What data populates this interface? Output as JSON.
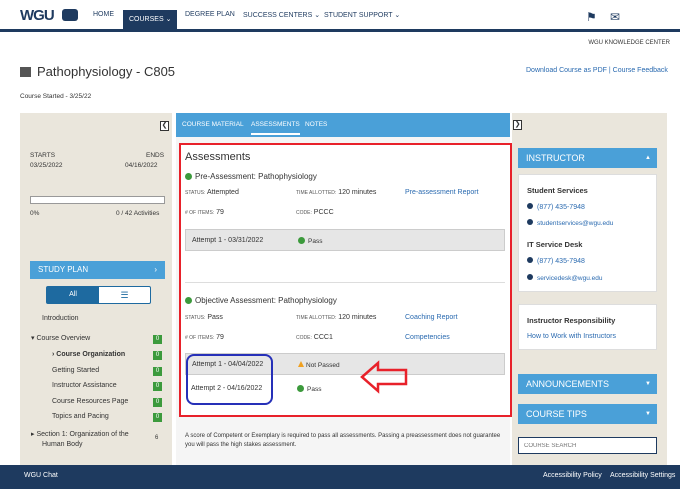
{
  "topnav": {
    "logo": "WGU",
    "items": [
      "HOME",
      "COURSES",
      "DEGREE PLAN",
      "SUCCESS CENTERS",
      "STUDENT SUPPORT"
    ],
    "icons": [
      "flag-icon",
      "mail-icon"
    ]
  },
  "knowledge_center": "WGU KNOWLEDGE CENTER",
  "course": {
    "title": "Pathophysiology - C805",
    "download": "Download Course as PDF",
    "separator": "|",
    "feedback": "Course Feedback",
    "started": "Course Started - 3/25/22"
  },
  "left": {
    "starts_label": "STARTS",
    "starts": "03/25/2022",
    "ends_label": "ENDS",
    "ends": "04/16/2022",
    "percent": "0%",
    "progress_fraction": 0,
    "activities": "0 / 42 Activities",
    "study_plan": "STUDY PLAN",
    "toggle_all": "All",
    "items": [
      {
        "label": "Introduction",
        "badge": ""
      },
      {
        "label": "Course Overview",
        "badge": "0"
      },
      {
        "label": "Course Organization",
        "badge": "0"
      },
      {
        "label": "Getting Started",
        "badge": "0"
      },
      {
        "label": "Instructor Assistance",
        "badge": "0"
      },
      {
        "label": "Course Resources Page",
        "badge": "0"
      },
      {
        "label": "Topics and Pacing",
        "badge": "0"
      },
      {
        "label": "Section 1: Organization of the",
        "label2": "Human Body",
        "badge": "6"
      }
    ]
  },
  "tabs": [
    "COURSE MATERIAL",
    "ASSESSMENTS",
    "NOTES"
  ],
  "assessments": {
    "title": "Assessments",
    "pre": {
      "name": "Pre-Assessment: Pathophysiology",
      "status_label": "STATUS:",
      "status": "Attempted",
      "time_label": "TIME ALLOTTED:",
      "time": "120 minutes",
      "report": "Pre-assessment Report",
      "items_label": "# OF ITEMS:",
      "items": "79",
      "code_label": "CODE:",
      "code": "PCCC",
      "attempts": [
        {
          "label": "Attempt 1 - 03/31/2022",
          "result": "Pass"
        }
      ]
    },
    "obj": {
      "name": "Objective Assessment: Pathophysiology",
      "status_label": "STATUS:",
      "status": "Pass",
      "time_label": "TIME ALLOTTED:",
      "time": "120 minutes",
      "report": "Coaching Report",
      "items_label": "# OF ITEMS:",
      "items": "79",
      "code_label": "CODE:",
      "code": "CCC1",
      "competencies": "Competencies",
      "attempts": [
        {
          "label": "Attempt 1 - 04/04/2022",
          "result": "Not Passed"
        },
        {
          "label": "Attempt 2 - 04/16/2022",
          "result": "Pass"
        }
      ]
    },
    "disclaimer": "A score of Competent or Exemplary is required to pass all assessments. Passing a preassessment does not guarantee you will pass the high stakes assessment."
  },
  "right": {
    "instructor": "INSTRUCTOR",
    "student_services": "Student Services",
    "ss_phone": "(877) 435-7948",
    "ss_email": "studentservices@wgu.edu",
    "it_desk": "IT Service Desk",
    "it_phone": "(877) 435-7948",
    "it_email": "servicedesk@wgu.edu",
    "responsibility": "Instructor Responsibility",
    "how_to": "How to Work with Instructors",
    "announcements": "ANNOUNCEMENTS",
    "course_tips": "COURSE TIPS",
    "search_placeholder": "COURSE SEARCH"
  },
  "bottom": {
    "chat": "WGU Chat",
    "policy": "Accessibility Policy",
    "settings": "Accessibility Settings"
  },
  "colors": {
    "navy": "#1e3a5f",
    "blue": "#4aa0d8",
    "red": "#e8212a",
    "green": "#3c9a3c"
  }
}
